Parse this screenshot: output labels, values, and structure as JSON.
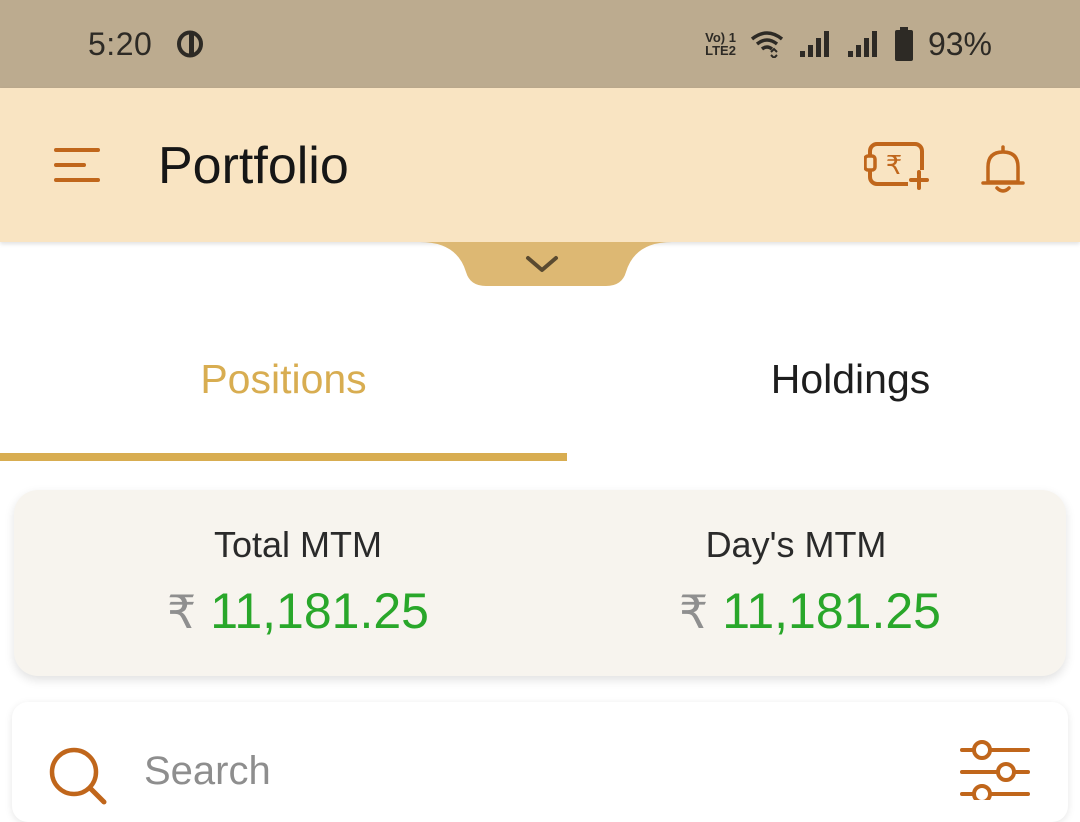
{
  "status_bar": {
    "time": "5:20",
    "volte_top": "Vo) 1",
    "volte_bottom": "LTE2",
    "battery_percent": "93%",
    "icons": [
      "o-notification-icon",
      "wifi-icon",
      "signal-icon",
      "signal-icon",
      "battery-icon"
    ]
  },
  "app_bar": {
    "title": "Portfolio",
    "icons": [
      "menu-icon",
      "add-funds-icon",
      "bell-icon"
    ]
  },
  "tabs": [
    {
      "label": "Positions",
      "active": true
    },
    {
      "label": "Holdings",
      "active": false
    }
  ],
  "mtm": {
    "currency_symbol": "₹",
    "total_label": "Total MTM",
    "total_value": "11,181.25",
    "day_label": "Day's MTM",
    "day_value": "11,181.25"
  },
  "search": {
    "placeholder": "Search"
  },
  "colors": {
    "status_bar_bg": "#bcab8f",
    "app_bar_bg": "#f9e4c2",
    "accent_gold": "#d8ad51",
    "icon_orange": "#c0661b",
    "profit_green": "#29a72a"
  }
}
